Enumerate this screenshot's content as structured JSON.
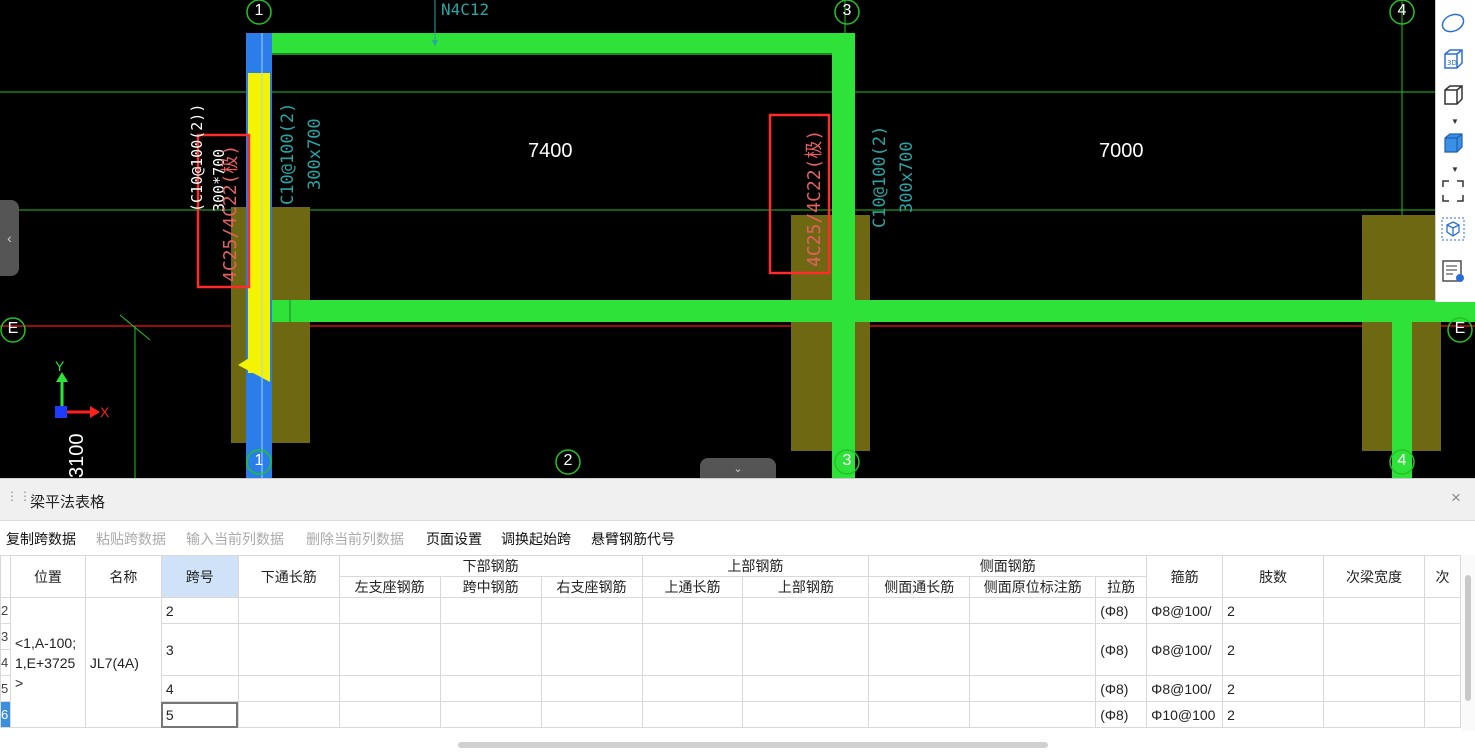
{
  "cad": {
    "axis_top": [
      "1",
      "3",
      "4"
    ],
    "axis_bottom": [
      "1",
      "2",
      "3",
      "4"
    ],
    "axis_side": "E",
    "top_rebar_label": "N4C12",
    "span_dim_1": "7400",
    "span_dim_2": "7000",
    "side_dim": "3100",
    "col1_stirrup_text": "(C10@100(2))",
    "col1_size_text": "300*700",
    "col1_red_text": "4C25/4C22(极)",
    "col1_cyan_a": "C10@100(2)",
    "col1_cyan_b": "300x700",
    "col3_red_text": "4C25/4C22(极)",
    "col3_cyan_a": "C10@100(2)",
    "col3_cyan_b": "300x700",
    "ucs_y": "Y",
    "ucs_x": "X",
    "colors": {
      "beam": "#2ee23a",
      "selected_beam": "#f4f400",
      "column_fill": "#6f6812",
      "axis": "#25c225",
      "red_line": "#cc1111",
      "highlight_box": "#ff2a2a",
      "cyan_text": "#2aa4a4",
      "red_text": "#e46060"
    }
  },
  "tools": [
    "orbit-icon",
    "view-3d-icon",
    "cube-icon",
    "cube-filled-icon",
    "fullscreen-icon",
    "box-select-icon",
    "report-icon"
  ],
  "panel": {
    "title": "梁平法表格",
    "close": "×",
    "toolbar": [
      {
        "label": "复制跨数据",
        "enabled": true
      },
      {
        "label": "粘贴跨数据",
        "enabled": false
      },
      {
        "label": "输入当前列数据",
        "enabled": false
      },
      {
        "label": "删除当前列数据",
        "enabled": false
      },
      {
        "label": "页面设置",
        "enabled": true
      },
      {
        "label": "调换起始跨",
        "enabled": true
      },
      {
        "label": "悬臂钢筋代号",
        "enabled": true
      }
    ]
  },
  "table": {
    "headers": {
      "position": "位置",
      "name": "名称",
      "span": "跨号",
      "bottom_through": "下通长筋",
      "bottom_group": "下部钢筋",
      "left_support": "左支座钢筋",
      "mid_span": "跨中钢筋",
      "right_support": "右支座钢筋",
      "top_group": "上部钢筋",
      "top_through": "上通长筋",
      "top_rebar": "上部钢筋",
      "side_group": "侧面钢筋",
      "side_through": "侧面通长筋",
      "side_orig": "侧面原位标注筋",
      "tie": "拉筋",
      "stirrup": "箍筋",
      "legs": "肢数",
      "sec_width": "次梁宽度",
      "more": "次"
    },
    "merged": {
      "position": "<1,A-100;1,E+3725>",
      "name": "JL7(4A)"
    },
    "rows": [
      {
        "num": "2",
        "span": "2",
        "tie": "(Φ8)",
        "stirrup": "Φ8@100/",
        "legs": "2"
      },
      {
        "num": "3",
        "span": "3",
        "tie": "(Φ8)",
        "stirrup": "Φ8@100/",
        "legs": "2"
      },
      {
        "num": "4",
        "span": "4",
        "tie": "(Φ8)",
        "stirrup": "Φ8@100/",
        "legs": "2"
      },
      {
        "num": "5",
        "span": "",
        "tie": "(Φ8)",
        "stirrup": "Φ8@100/",
        "legs": "2"
      },
      {
        "num": "6",
        "span": "5",
        "tie": "(Φ8)",
        "stirrup": "Φ10@100",
        "legs": "2"
      }
    ]
  }
}
